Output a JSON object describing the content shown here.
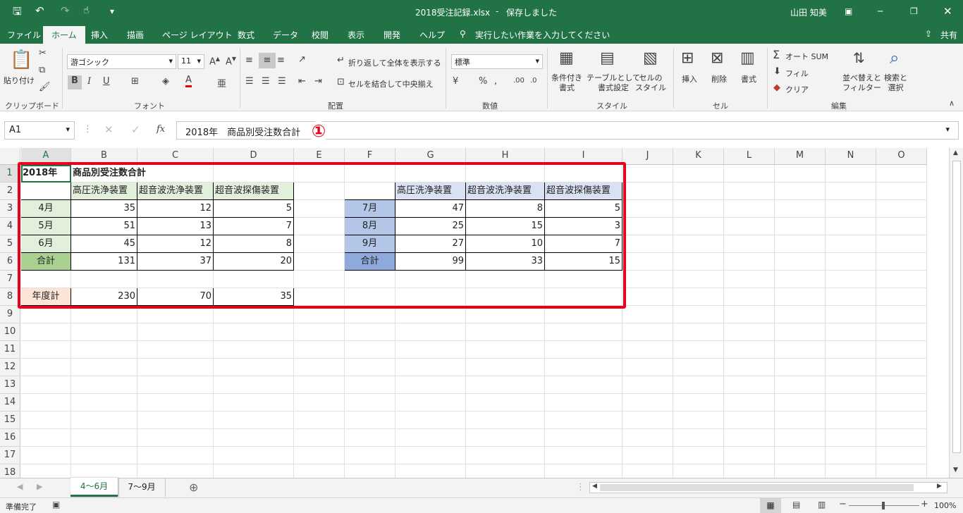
{
  "titlebar": {
    "filename": "2018受注記録.xlsx",
    "separator": "-",
    "save_status": "保存しました",
    "user": "山田 知美"
  },
  "tabs": [
    "ファイル",
    "ホーム",
    "挿入",
    "描画",
    "ページ レイアウト",
    "数式",
    "データ",
    "校閲",
    "表示",
    "開発",
    "ヘルプ"
  ],
  "tell_me": "実行したい作業を入力してください",
  "share": "共有",
  "ribbon": {
    "clipboard": {
      "paste": "貼り付け",
      "label": "クリップボード"
    },
    "font": {
      "name": "游ゴシック",
      "size": "11",
      "bold": "B",
      "italic": "I",
      "underline": "U",
      "label": "フォント"
    },
    "alignment": {
      "wrap": "折り返して全体を表示する",
      "merge": "セルを結合して中央揃え",
      "label": "配置"
    },
    "number": {
      "format": "標準",
      "label": "数値"
    },
    "styles": {
      "conditional": "条件付き\n書式",
      "table": "テーブルとして\n書式設定",
      "cellstyle": "セルの\nスタイル",
      "label": "スタイル"
    },
    "cells": {
      "insert": "挿入",
      "delete": "削除",
      "format": "書式",
      "label": "セル"
    },
    "editing": {
      "autosum": "オート SUM",
      "fill": "フィル",
      "clear": "クリア",
      "sort": "並べ替えと\nフィルター",
      "find": "検索と\n選択",
      "label": "編集"
    }
  },
  "formula_bar": {
    "name_box": "A1",
    "fx": "fx",
    "content": "2018年　商品別受注数合計",
    "annotation": "①"
  },
  "columns": [
    "A",
    "B",
    "C",
    "D",
    "E",
    "F",
    "G",
    "H",
    "I",
    "J",
    "K",
    "L",
    "M",
    "N",
    "O"
  ],
  "rows": [
    "1",
    "2",
    "3",
    "4",
    "5",
    "6",
    "7",
    "8",
    "9",
    "10",
    "11",
    "12",
    "13",
    "14",
    "15",
    "16",
    "17",
    "18"
  ],
  "table1": {
    "title1": "2018年",
    "title2": "商品別受注数合計",
    "headers": [
      "高圧洗浄装置",
      "超音波洗浄装置",
      "超音波探傷装置"
    ],
    "rows": [
      {
        "label": "4月",
        "values": [
          "35",
          "12",
          "5"
        ]
      },
      {
        "label": "5月",
        "values": [
          "51",
          "13",
          "7"
        ]
      },
      {
        "label": "6月",
        "values": [
          "45",
          "12",
          "8"
        ]
      },
      {
        "label": "合計",
        "values": [
          "131",
          "37",
          "20"
        ]
      }
    ],
    "year_total": {
      "label": "年度計",
      "values": [
        "230",
        "70",
        "35"
      ]
    }
  },
  "table2": {
    "headers": [
      "高圧洗浄装置",
      "超音波洗浄装置",
      "超音波探傷装置"
    ],
    "rows": [
      {
        "label": "7月",
        "values": [
          "47",
          "8",
          "5"
        ]
      },
      {
        "label": "8月",
        "values": [
          "25",
          "15",
          "3"
        ]
      },
      {
        "label": "9月",
        "values": [
          "27",
          "10",
          "7"
        ]
      },
      {
        "label": "合計",
        "values": [
          "99",
          "33",
          "15"
        ]
      }
    ]
  },
  "sheet_tabs": [
    "4～6月",
    "7～9月"
  ],
  "status": {
    "ready": "準備完了",
    "zoom": "100%"
  },
  "colors": {
    "excel_green": "#217346",
    "highlight_red": "#e8001c",
    "light_green": "#e2efda",
    "green": "#a9d08e",
    "light_blue": "#d9e1f2",
    "blue": "#b4c6e7",
    "dark_blue": "#8ea9db",
    "peach": "#fce4d6"
  }
}
